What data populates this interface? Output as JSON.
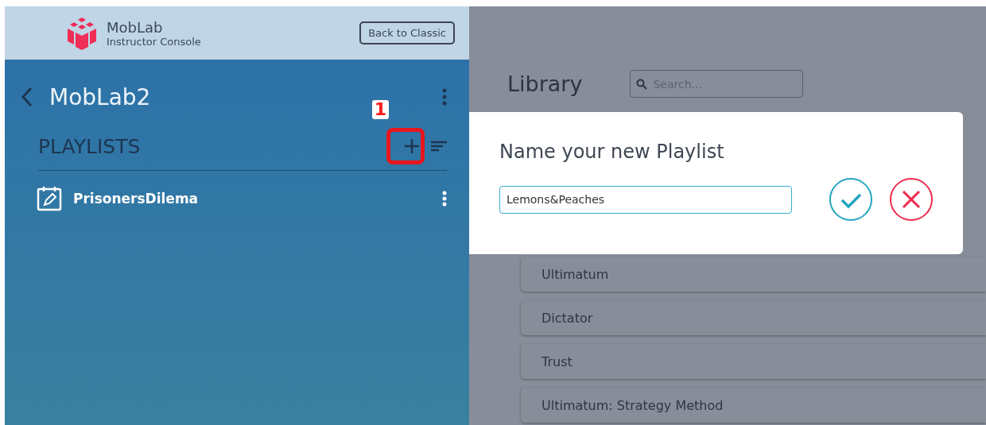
{
  "header": {
    "brand": "MobLab",
    "subtitle": "Instructor Console",
    "back_button": "Back to Classic"
  },
  "sidebar": {
    "title": "MobLab2",
    "section": "PLAYLISTS",
    "annotation": "1",
    "items": [
      {
        "label": "PrisonersDilema"
      }
    ]
  },
  "library": {
    "title": "Library",
    "search": {
      "placeholder": "Search..."
    },
    "games": [
      "Ultimatum",
      "Dictator",
      "Trust",
      "Ultimatum: Strategy Method"
    ]
  },
  "dialog": {
    "title": "Name your new Playlist",
    "value": "Lemons&Peaches"
  }
}
